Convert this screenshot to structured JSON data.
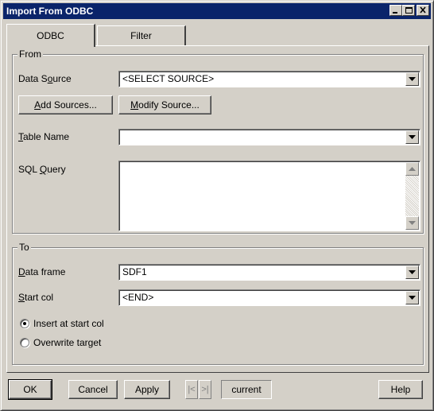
{
  "window": {
    "title": "Import From ODBC"
  },
  "title_buttons": {
    "minimize": "minimize-icon",
    "maximize": "maximize-icon",
    "close": "close-icon"
  },
  "tabs": [
    {
      "label": "ODBC",
      "active": true
    },
    {
      "label": "Filter",
      "active": false
    }
  ],
  "from": {
    "group_label": "From",
    "data_source_label": "Data Source",
    "data_source_value": "<SELECT SOURCE>",
    "add_sources_label": "Add Sources...",
    "modify_source_label": "Modify Source...",
    "table_name_label": "Table Name",
    "table_name_value": "",
    "sql_query_label": "SQL Query",
    "sql_query_value": ""
  },
  "to": {
    "group_label": "To",
    "data_frame_label": "Data frame",
    "data_frame_value": "SDF1",
    "start_col_label": "Start col",
    "start_col_value": "<END>",
    "radios": [
      {
        "label": "Insert at start col",
        "checked": true
      },
      {
        "label": "Overwrite target",
        "checked": false
      }
    ]
  },
  "footer": {
    "ok_label": "OK",
    "cancel_label": "Cancel",
    "apply_label": "Apply",
    "prev_label": "|<",
    "next_label": ">|",
    "current_label": "current",
    "help_label": "Help"
  }
}
